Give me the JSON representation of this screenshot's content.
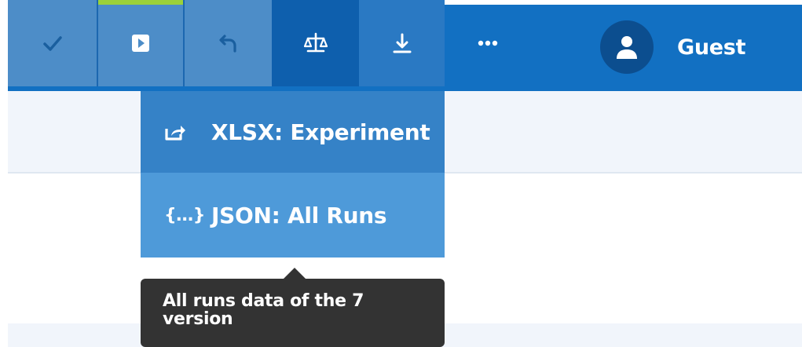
{
  "toolbar": {
    "buttons": [
      {
        "name": "complete",
        "icon": "check-icon"
      },
      {
        "name": "run",
        "icon": "play-icon"
      },
      {
        "name": "undo",
        "icon": "undo-icon"
      },
      {
        "name": "compare",
        "icon": "balance-scale-icon"
      },
      {
        "name": "download",
        "icon": "download-icon"
      },
      {
        "name": "more",
        "icon": "more-icon"
      }
    ],
    "user": {
      "name": "Guest",
      "icon": "user-icon"
    }
  },
  "dropdown": {
    "items": [
      {
        "label": "XLSX: Experiment",
        "icon": "export-icon"
      },
      {
        "label": "JSON: All Runs",
        "icon": "json-icon",
        "glyph": "{...}"
      }
    ]
  },
  "tooltip": {
    "line1": "All runs data of the 7",
    "line2": "version"
  },
  "colors": {
    "toolbar": "#1270c2",
    "toolbar_light": "#4d8dc8",
    "toolbar_dark": "#0e5fad",
    "accent_green": "#9bd13a",
    "dropdown_export": "#3582c7",
    "dropdown_json": "#4e9ad9",
    "tooltip_bg": "#333333",
    "subbar_bg": "#f1f5fb"
  }
}
